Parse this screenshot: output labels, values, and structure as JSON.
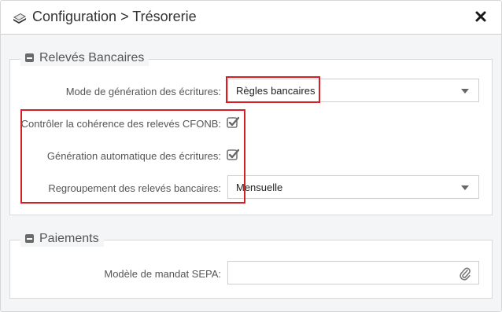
{
  "dialog": {
    "title": "Configuration > Trésorerie",
    "icon": "money-stack-icon",
    "close_icon": "close-icon"
  },
  "releves_bancaires": {
    "legend": "Relevés Bancaires",
    "mode_generation": {
      "label": "Mode de génération des écritures:",
      "value": "Règles bancaires"
    },
    "coherence_cfonb": {
      "label": "Contrôler la cohérence des relevés CFONB:",
      "checked": true
    },
    "generation_auto": {
      "label": "Génération automatique des écritures:",
      "checked": true
    },
    "regroupement": {
      "label": "Regroupement des relevés bancaires:",
      "value": "Mensuelle"
    }
  },
  "paiements": {
    "legend": "Paiements",
    "mandat_sepa": {
      "label": "Modèle de mandat SEPA:",
      "value": "",
      "icon": "paperclip-icon"
    }
  },
  "colors": {
    "highlight": "#d81f26",
    "body_bg": "#f4f5f6",
    "border": "#cfcfcf"
  }
}
